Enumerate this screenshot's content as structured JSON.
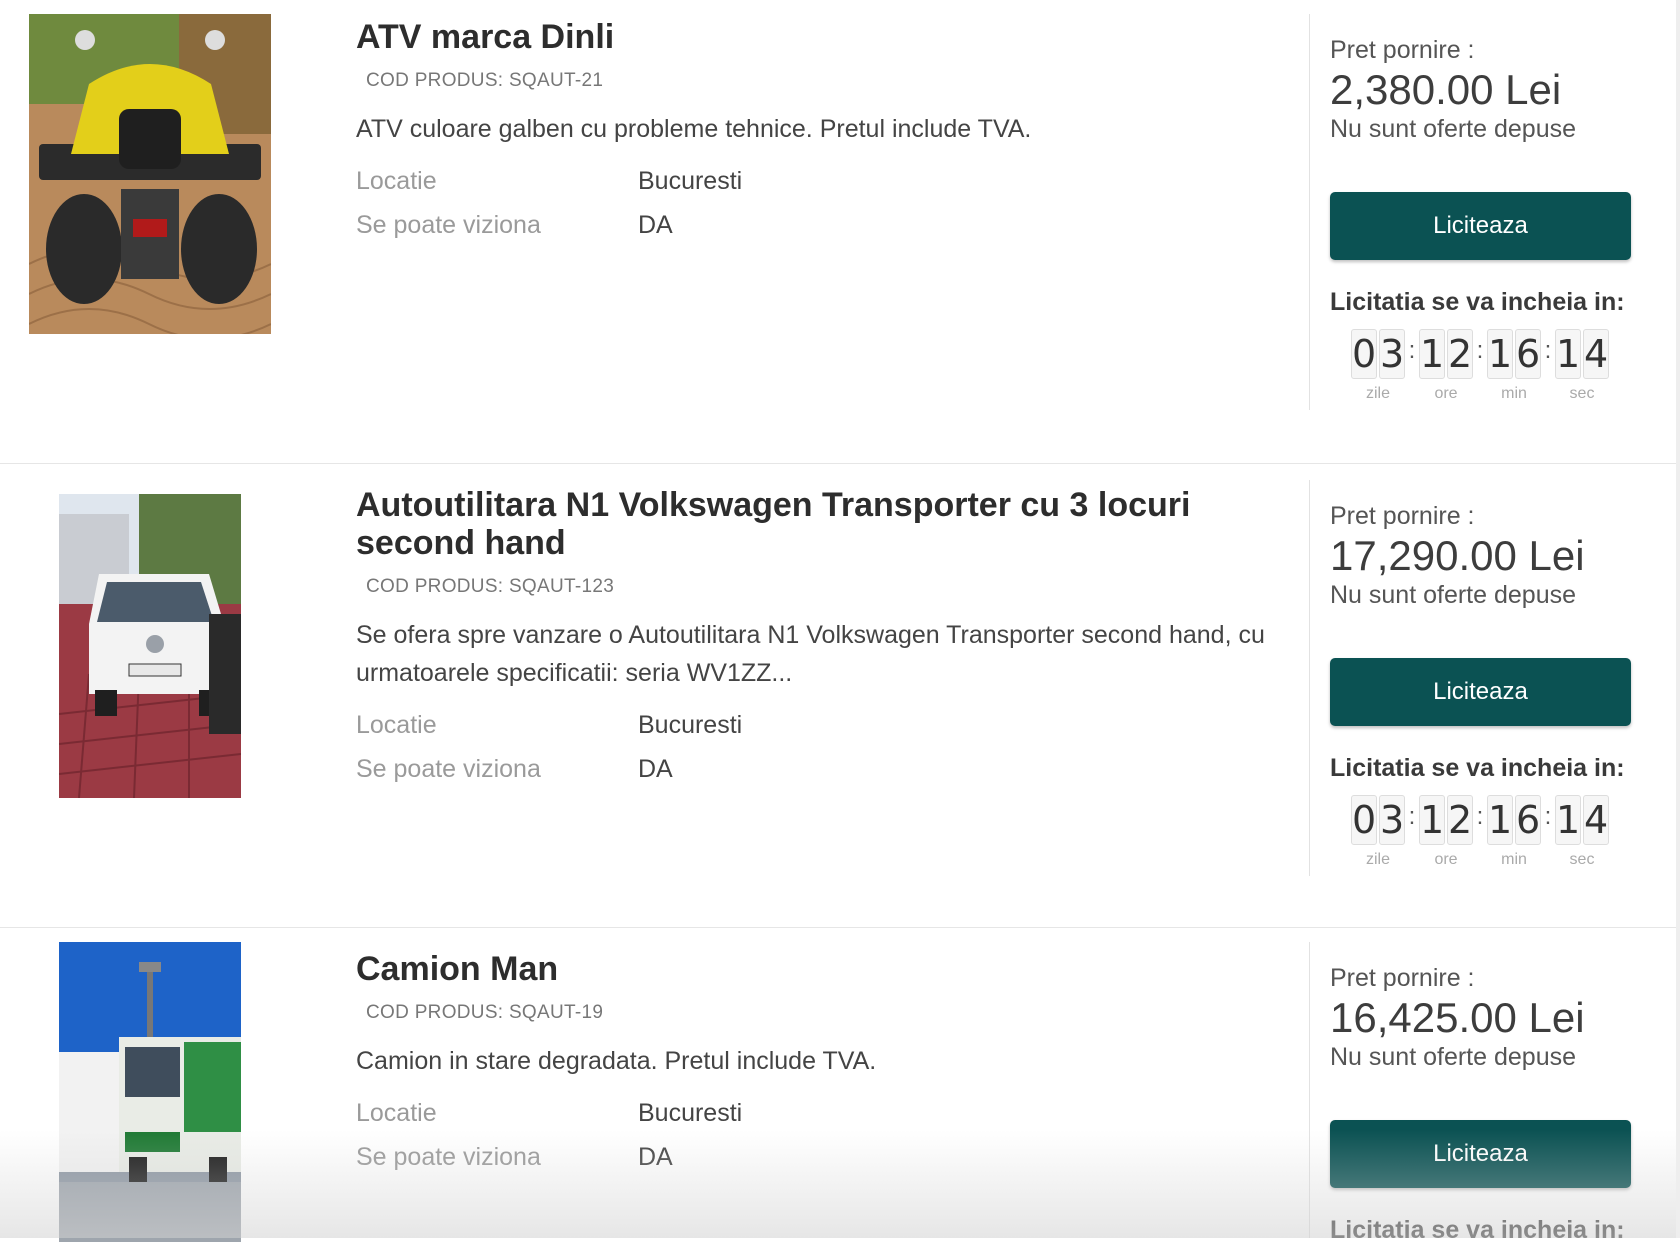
{
  "listings": [
    {
      "title": "ATV marca Dinli",
      "code": "COD PRODUS: SQAUT-21",
      "description": "ATV culoare galben cu probleme tehnice. Pretul include TVA.",
      "location_label": "Locatie",
      "location_value": "Bucuresti",
      "viewing_label": "Se poate viziona",
      "viewing_value": "DA",
      "price_label": "Pret pornire :",
      "price_value": "2,380.00 Lei",
      "offers_text": "Nu sunt oferte depuse",
      "bid_label": "Liciteaza",
      "ends_label": "Licitatia se va incheia in:",
      "countdown": [
        {
          "d1": "0",
          "d2": "3",
          "unit": "zile"
        },
        {
          "d1": "1",
          "d2": "2",
          "unit": "ore"
        },
        {
          "d1": "1",
          "d2": "6",
          "unit": "min"
        },
        {
          "d1": "1",
          "d2": "4",
          "unit": "sec"
        }
      ],
      "photo_icon": "atv-photo"
    },
    {
      "title": "Autoutilitara N1 Volkswagen Transporter cu 3 locuri second hand",
      "code": "COD PRODUS: SQAUT-123",
      "description": "Se ofera spre vanzare o Autoutilitara N1 Volkswagen Transporter second hand, cu urmatoarele specificatii: seria WV1ZZ...",
      "location_label": "Locatie",
      "location_value": "Bucuresti",
      "viewing_label": "Se poate viziona",
      "viewing_value": "DA",
      "price_label": "Pret pornire :",
      "price_value": "17,290.00 Lei",
      "offers_text": "Nu sunt oferte depuse",
      "bid_label": "Liciteaza",
      "ends_label": "Licitatia se va incheia in:",
      "countdown": [
        {
          "d1": "0",
          "d2": "3",
          "unit": "zile"
        },
        {
          "d1": "1",
          "d2": "2",
          "unit": "ore"
        },
        {
          "d1": "1",
          "d2": "6",
          "unit": "min"
        },
        {
          "d1": "1",
          "d2": "4",
          "unit": "sec"
        }
      ],
      "photo_icon": "van-photo"
    },
    {
      "title": "Camion Man",
      "code": "COD PRODUS: SQAUT-19",
      "description": "Camion in stare degradata. Pretul include TVA.",
      "location_label": "Locatie",
      "location_value": "Bucuresti",
      "viewing_label": "Se poate viziona",
      "viewing_value": "DA",
      "price_label": "Pret pornire :",
      "price_value": "16,425.00 Lei",
      "offers_text": "Nu sunt oferte depuse",
      "bid_label": "Liciteaza",
      "ends_label": "Licitatia se va incheia in:",
      "photo_icon": "truck-photo"
    }
  ],
  "colors": {
    "button_bg": "#0b5253",
    "button_text": "#ffffff",
    "label_gray": "#9a9a9a"
  }
}
